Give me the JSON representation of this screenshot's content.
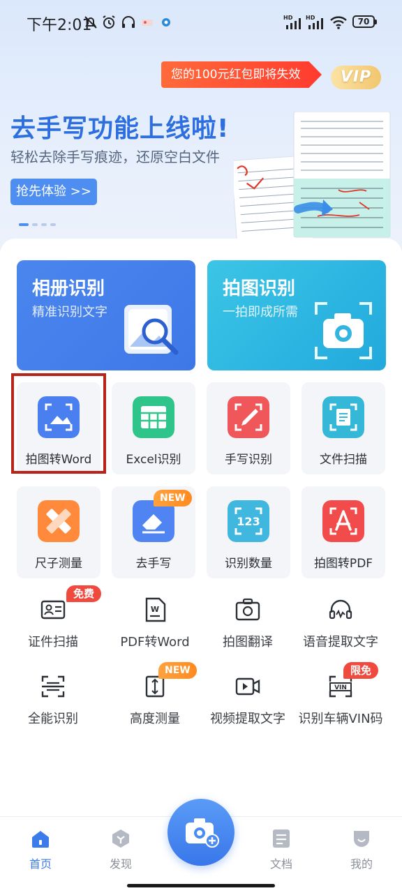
{
  "status_bar": {
    "time": "下午2:01",
    "battery": "70",
    "icons": [
      "mute-icon",
      "alarm-icon",
      "headphones-icon",
      "hd-signal-icon",
      "hd-signal-icon",
      "wifi-icon",
      "battery-icon"
    ]
  },
  "promo": {
    "red_packet_text": "您的100元红包即将失效",
    "vip_label": "VIP"
  },
  "banner": {
    "title": "去手写功能上线啦!",
    "subtitle": "轻松去除手写痕迹，还原空白文件",
    "button_label": "抢先体验 >>",
    "page_count": 4,
    "active_page": 1
  },
  "feature_cards": [
    {
      "title": "相册识别",
      "subtitle": "精准识别文字",
      "icon": "gallery-search-icon"
    },
    {
      "title": "拍图识别",
      "subtitle": "一拍即成所需",
      "icon": "camera-scan-icon"
    }
  ],
  "tools_row1": [
    {
      "label": "拍图转Word",
      "icon": "photo-to-word-icon",
      "color": "#4a7ff0",
      "highlighted": true
    },
    {
      "label": "Excel识别",
      "icon": "excel-icon",
      "color": "#2ec48a"
    },
    {
      "label": "手写识别",
      "icon": "handwriting-icon",
      "color": "#f0575a"
    },
    {
      "label": "文件扫描",
      "icon": "file-scan-icon",
      "color": "#35b7d8"
    }
  ],
  "tools_row2": [
    {
      "label": "尺子测量",
      "icon": "ruler-icon",
      "color": "#ff8a3c"
    },
    {
      "label": "去手写",
      "icon": "eraser-icon",
      "color": "#4f84f2",
      "badge": "NEW"
    },
    {
      "label": "识别数量",
      "icon": "count-123-icon",
      "color": "#3fb7de"
    },
    {
      "label": "拍图转PDF",
      "icon": "pdf-icon",
      "color": "#f24b4b"
    }
  ],
  "small_tools": [
    {
      "label": "证件扫描",
      "icon": "id-card-icon",
      "badge": "免费"
    },
    {
      "label": "PDF转Word",
      "icon": "pdf-to-word-icon"
    },
    {
      "label": "拍图翻译",
      "icon": "photo-translate-icon"
    },
    {
      "label": "语音提取文字",
      "icon": "voice-text-icon"
    },
    {
      "label": "全能识别",
      "icon": "all-recognize-icon"
    },
    {
      "label": "高度测量",
      "icon": "height-measure-icon",
      "badge": "NEW"
    },
    {
      "label": "视频提取文字",
      "icon": "video-text-icon"
    },
    {
      "label": "识别车辆VIN码",
      "icon": "vin-icon",
      "badge": "限免"
    }
  ],
  "bottom_nav": {
    "items": [
      {
        "label": "首页",
        "icon": "home-icon",
        "active": true
      },
      {
        "label": "发现",
        "icon": "discover-icon",
        "active": false
      },
      {
        "label": "文档",
        "icon": "document-icon",
        "active": false
      },
      {
        "label": "我的",
        "icon": "profile-icon",
        "active": false
      }
    ],
    "center_icon": "camera-plus-icon"
  },
  "colors": {
    "accent": "#3b7bea",
    "promo_red": "#ff3b2f",
    "badge_orange": "#ff8a1f",
    "badge_red": "#f04a3e",
    "highlight_border": "#b8231a"
  }
}
